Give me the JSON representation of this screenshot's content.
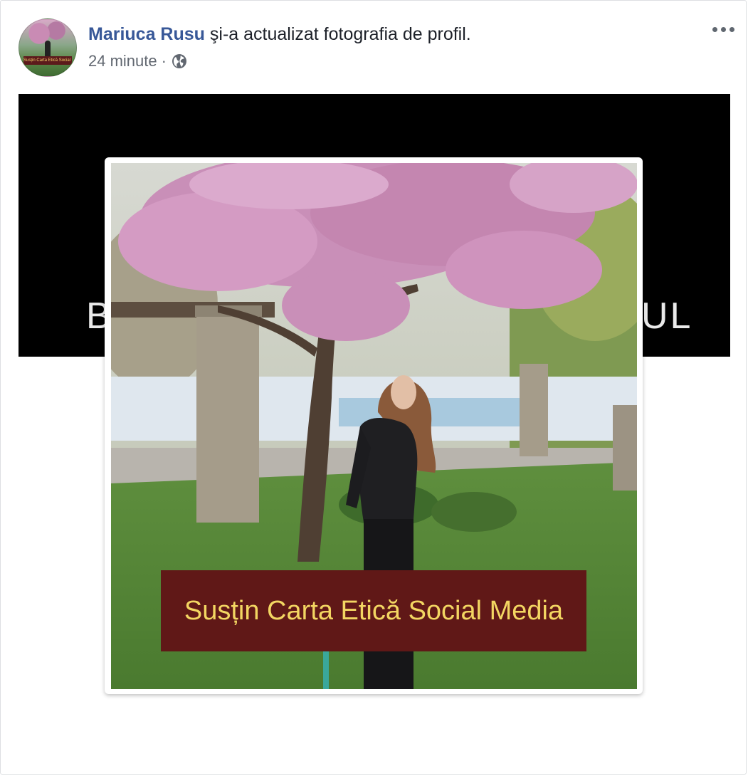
{
  "post": {
    "author_name": "Mariuca Rusu",
    "action_text": " şi-a actualizat fotografia de profil.",
    "timestamp": "24 minute",
    "separator": "·",
    "privacy_icon": "globe-icon",
    "more_icon": "more-options-icon"
  },
  "cover": {
    "text_left": "BE",
    "text_right": "UL"
  },
  "profile_photo": {
    "banner_text": "Susțin Carta Etică Social Media",
    "avatar_banner_text": "Susțin Carta Etică Social Media"
  },
  "colors": {
    "author_link": "#385898",
    "banner_bg": "#601817",
    "banner_text": "#f3d662",
    "cover_bg": "#000000"
  }
}
